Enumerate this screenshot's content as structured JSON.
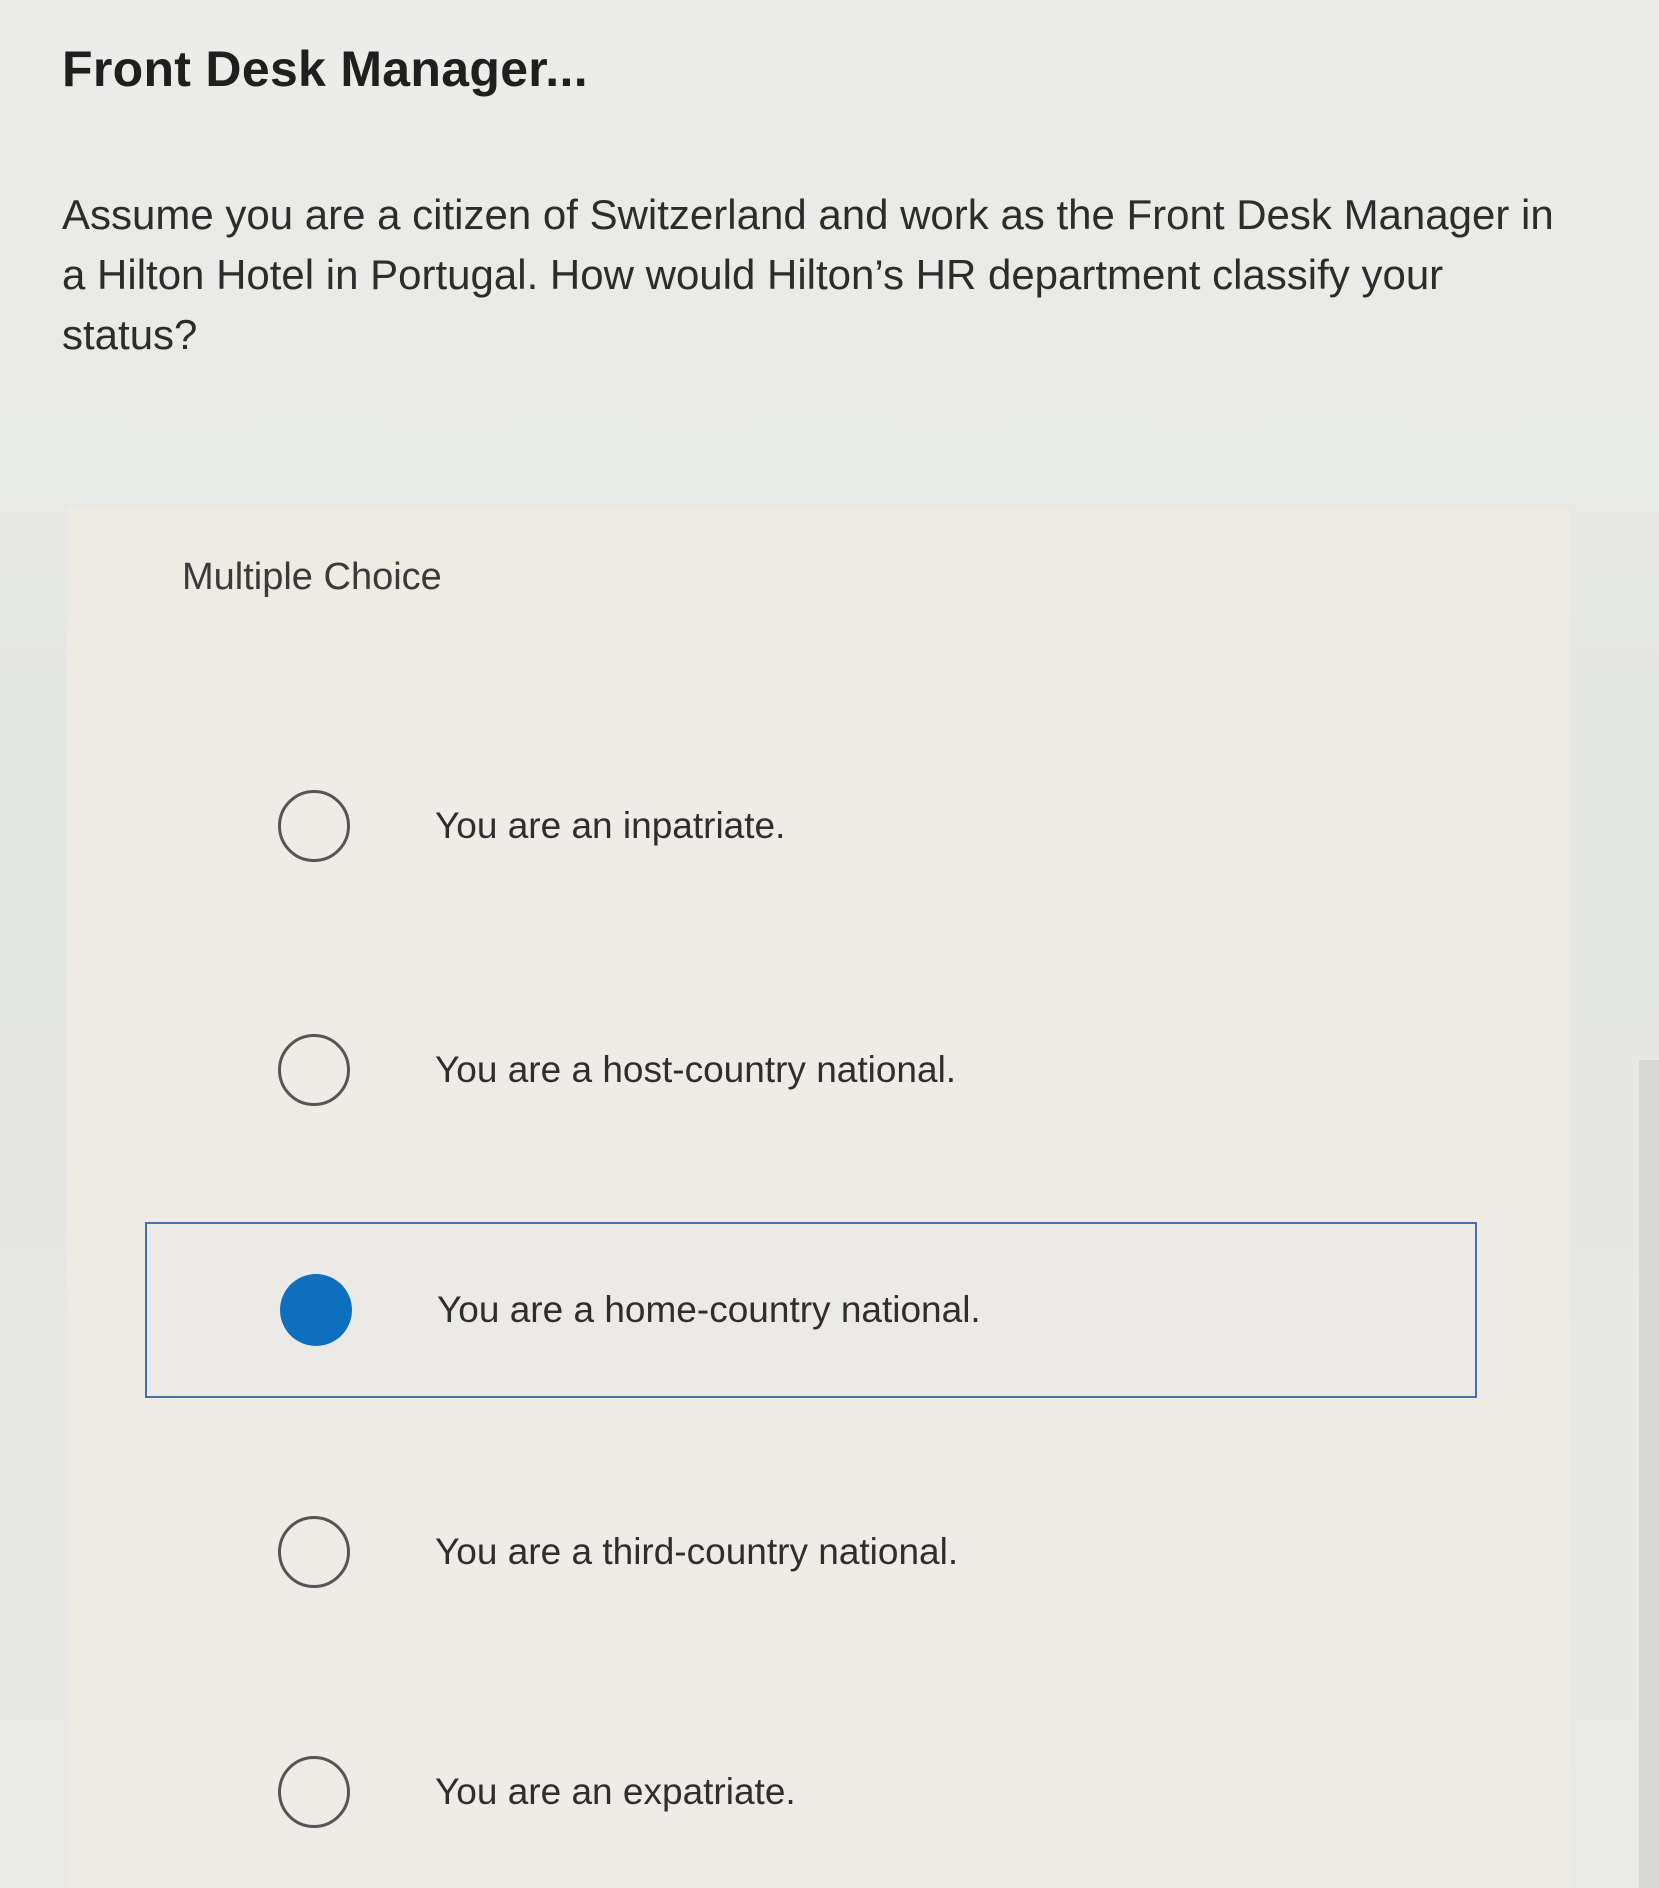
{
  "header": {
    "title": "Front Desk Manager..."
  },
  "question": {
    "text": "Assume you are a citizen of Switzerland and work as the Front Desk Manager in a Hilton Hotel in Portugal. How would Hilton’s HR department classify your status?"
  },
  "multiple_choice": {
    "label": "Multiple Choice",
    "selected_index": 2,
    "options": [
      {
        "label": "You are an inpatriate.",
        "selected": false
      },
      {
        "label": "You are a host-country national.",
        "selected": false
      },
      {
        "label": "You are a home-country national.",
        "selected": true
      },
      {
        "label": "You are a third-country national.",
        "selected": false
      },
      {
        "label": "You are an expatriate.",
        "selected": false
      }
    ]
  },
  "colors": {
    "selected_radio": "#0d6fbe",
    "selected_border": "#4a6fa5"
  }
}
